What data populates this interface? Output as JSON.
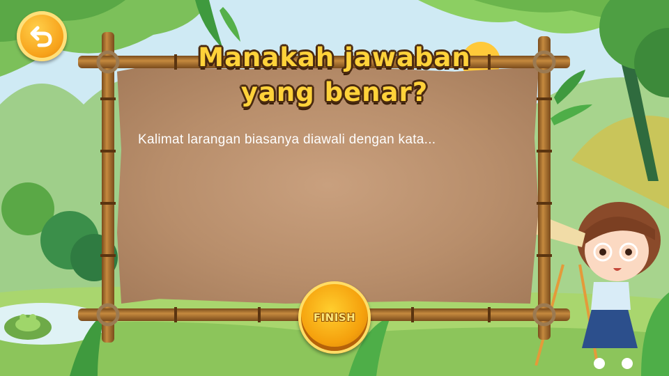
{
  "quiz": {
    "title_line1": "Manakah jawaban",
    "title_line2": "yang benar?",
    "question": "Kalimat larangan biasanya diawali dengan kata..."
  },
  "buttons": {
    "finish_label": "FINISH",
    "back_icon": "back-arrow-icon"
  },
  "colors": {
    "title_fill": "#ffd23a",
    "title_outline": "#4a2a10",
    "button_orange": "#f5a10d",
    "board": "#b88e6b"
  }
}
